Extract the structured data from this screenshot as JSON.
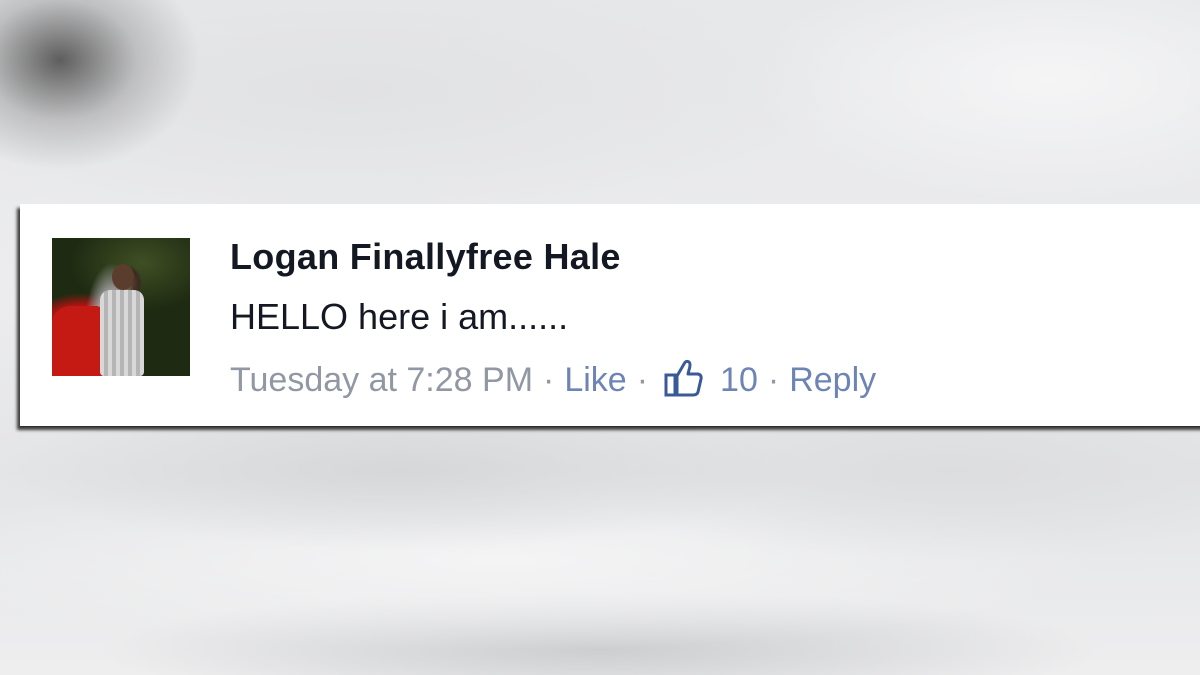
{
  "comment": {
    "author": "Logan Finallyfree Hale",
    "text": "HELLO here i am......",
    "timestamp": "Tuesday at 7:28 PM",
    "separator": "·",
    "like_label": "Like",
    "like_count": "10",
    "reply_label": "Reply",
    "like_icon": "thumbs-up-icon",
    "colors": {
      "author_text": "#141823",
      "meta_text": "#9197a3",
      "link_blue": "#6d84b4",
      "thumb_icon": "#3b5998"
    }
  }
}
